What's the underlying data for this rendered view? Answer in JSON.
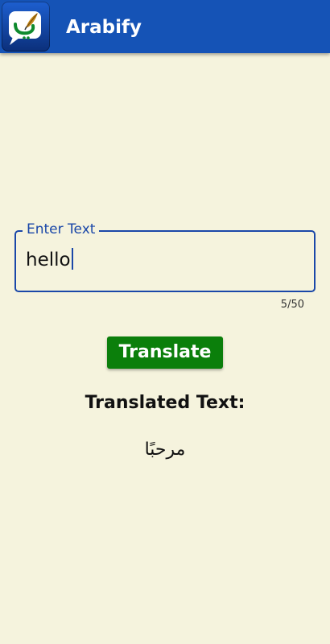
{
  "app_bar": {
    "title": "Arabify",
    "icon": "arabify-logo-icon",
    "color": "#1553b6"
  },
  "input": {
    "label": "Enter Text",
    "value": "hello",
    "counter": "5/50",
    "accent": "#1a47a8"
  },
  "translate_button": {
    "label": "Translate",
    "color": "#0b7f0b"
  },
  "result": {
    "heading": "Translated Text:",
    "text": "مرحبًا"
  },
  "background": "#f5f3dd"
}
